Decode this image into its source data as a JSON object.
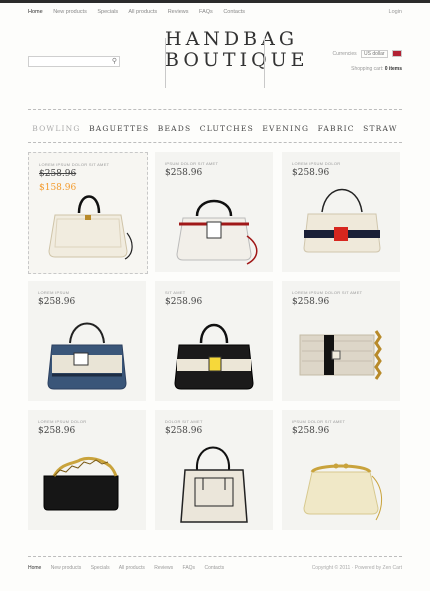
{
  "topnav": {
    "items": [
      {
        "label": "Home"
      },
      {
        "label": "New products"
      },
      {
        "label": "Specials"
      },
      {
        "label": "All products"
      },
      {
        "label": "Reviews"
      },
      {
        "label": "FAQs"
      },
      {
        "label": "Contacts"
      }
    ],
    "login": "Login"
  },
  "logo": {
    "line1": "HANDBAG",
    "line2": "BOUTIQUE"
  },
  "currency": {
    "label": "Currencies",
    "selected": "US dollar"
  },
  "cart": {
    "text": "Shopping cart:",
    "items": "0 items"
  },
  "menu": [
    "BOWLING",
    "BAGUETTES",
    "BEADS",
    "CLUTCHES",
    "EVENING",
    "FABRIC",
    "STRAW"
  ],
  "products": [
    {
      "name": "LOREM IPSUM DOLOR SIT AMET",
      "price": "$258.96",
      "sale": "$158.96"
    },
    {
      "name": "IPSUM DOLOR SIT AMET",
      "price": "$258.96"
    },
    {
      "name": "LOREM IPSUM DOLOR",
      "price": "$258.96"
    },
    {
      "name": "LOREM IPSUM",
      "price": "$258.96"
    },
    {
      "name": "SIT AMET",
      "price": "$258.96"
    },
    {
      "name": "LOREM IPSUM DOLOR SIT AMET",
      "price": "$258.96"
    },
    {
      "name": "LOREM IPSUM DOLOR",
      "price": "$258.96"
    },
    {
      "name": "DOLOR SIT AMET",
      "price": "$258.96"
    },
    {
      "name": "IPSUM DOLOR SIT AMET",
      "price": "$258.96"
    }
  ],
  "footer": {
    "nav": [
      "Home",
      "New products",
      "Specials",
      "All products",
      "Reviews",
      "FAQs",
      "Contacts"
    ],
    "copyright": "Copyright © 2011 · Powered by Zen Cart"
  }
}
